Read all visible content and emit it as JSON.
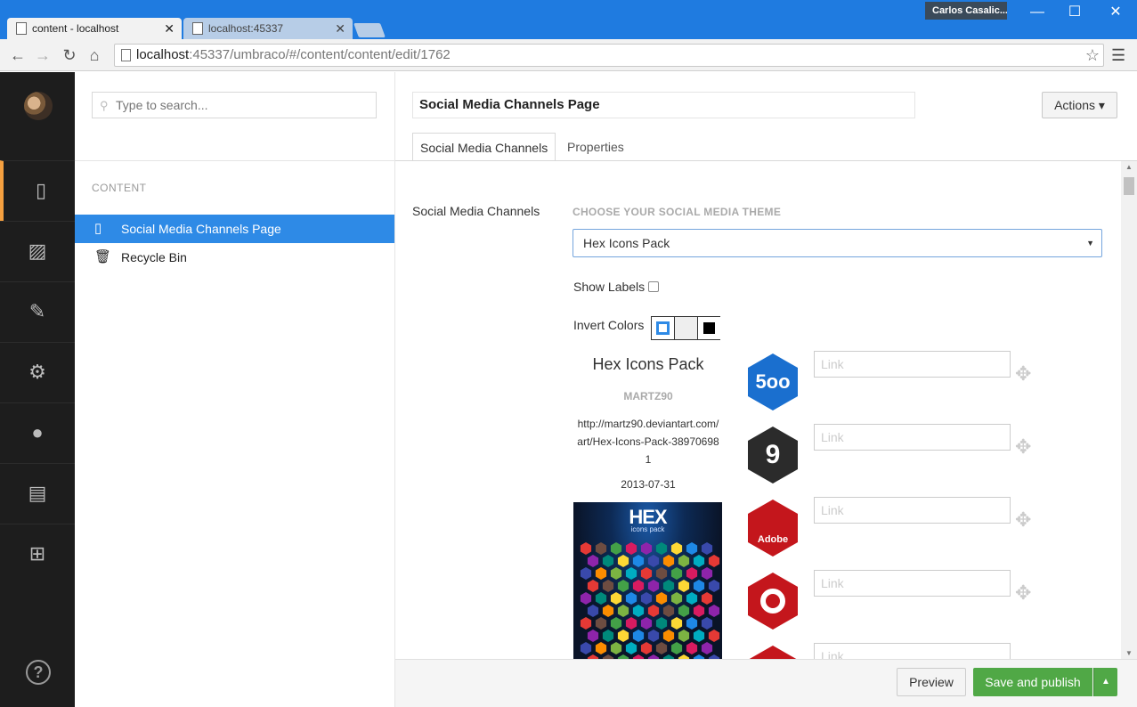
{
  "browser": {
    "tabs": [
      {
        "title": "content - localhost",
        "close": "✕"
      },
      {
        "title": "localhost:45337",
        "close": "✕"
      }
    ],
    "user": "Carlos Casalic...",
    "window_controls": {
      "minimize": "—",
      "maximize": "☐",
      "close": "✕"
    },
    "url_host": "localhost",
    "url_rest": ":45337/umbraco/#/content/content/edit/1762"
  },
  "search": {
    "placeholder": "Type to search..."
  },
  "tree": {
    "section_title": "CONTENT",
    "items": [
      {
        "label": "Social Media Channels Page"
      },
      {
        "label": "Recycle Bin"
      }
    ]
  },
  "editor": {
    "node_name": "Social Media Channels Page",
    "actions_label": "Actions ▾",
    "tabs": [
      {
        "label": "Social Media Channels"
      },
      {
        "label": "Properties"
      }
    ],
    "property_label": "Social Media Channels",
    "theme_label": "CHOOSE YOUR SOCIAL MEDIA THEME",
    "theme_value": "Hex Icons Pack",
    "show_labels": "Show Labels",
    "invert_colors": "Invert Colors",
    "pack": {
      "title": "Hex Icons Pack",
      "author": "MARTZ90",
      "url": "http://martz90.deviantart.com/art/Hex-Icons-Pack-389706981",
      "date": "2013-07-31",
      "image_title": "HEX",
      "image_subtitle": "icons pack"
    },
    "channels": [
      {
        "icon_text": "5oo",
        "color": "#1a6fcf",
        "placeholder": "Link"
      },
      {
        "icon_text": "9",
        "color": "#2b2b2b",
        "placeholder": "Link"
      },
      {
        "icon_text": "Adobe",
        "color": "#c4161c",
        "placeholder": "Link"
      },
      {
        "icon_text": "",
        "color": "#c4161c",
        "placeholder": "Link"
      },
      {
        "icon_text": "",
        "color": "#c4161c",
        "placeholder": "Link"
      }
    ]
  },
  "footer": {
    "preview": "Preview",
    "publish": "Save and publish"
  },
  "colors": {
    "accent": "#2e8ae6",
    "publish": "#50a846",
    "nav_active": "#f5a040"
  }
}
